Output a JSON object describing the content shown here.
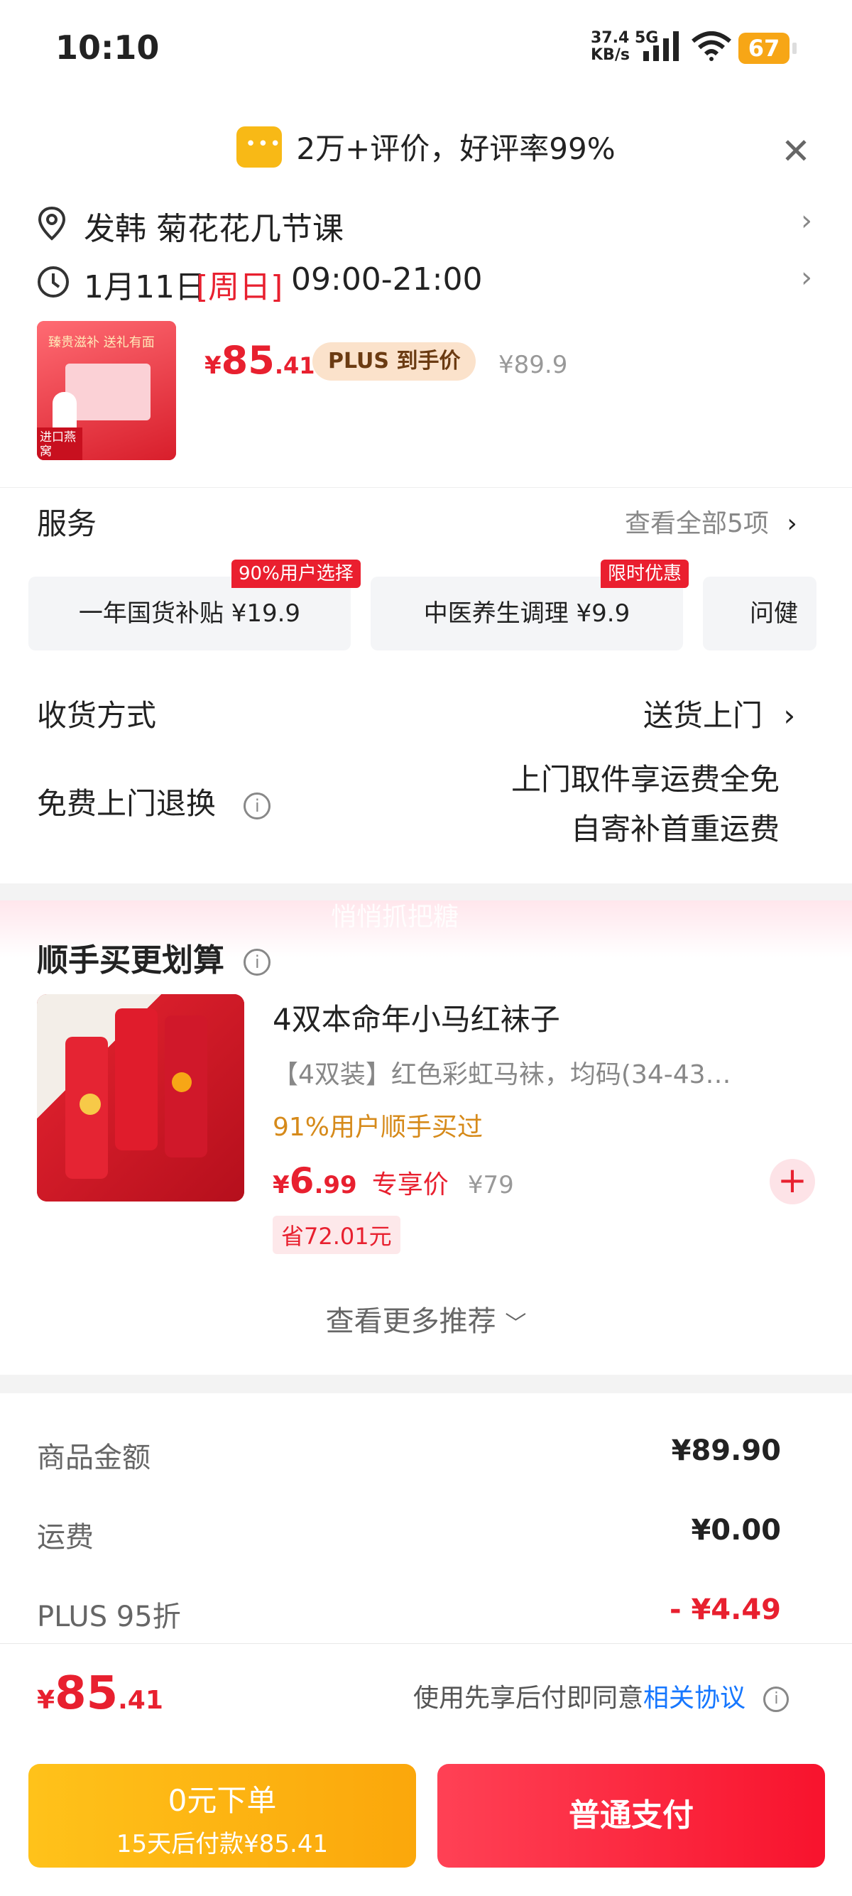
{
  "status": {
    "time": "10:10",
    "net_speed": "37.4",
    "net_unit": "KB/s",
    "net_type": "5G",
    "battery": "67"
  },
  "header": {
    "rating_text": "2万+评价，好评率99%"
  },
  "address": {
    "text": "发韩  菊花花几节课"
  },
  "delivery_time": {
    "date": "1月11日",
    "weekday": "[周日]",
    "range": "09:00-21:00"
  },
  "product": {
    "currency": "¥",
    "price_int": "85",
    "price_dec": ".41",
    "plus_badge_plus": "PLUS",
    "plus_badge_text": "到手价",
    "orig_price": "¥89.9",
    "image_text_top": "臻贵滋补  送礼有面",
    "image_text_corner": "进口燕窝"
  },
  "services": {
    "title": "服务",
    "view_all": "查看全部5项",
    "items": [
      {
        "tag": "90%用户选择",
        "label": "一年国货补贴  ¥19.9"
      },
      {
        "tag": "限时优惠",
        "label": "中医养生调理  ¥9.9"
      },
      {
        "tag": "",
        "label": "问健康"
      }
    ]
  },
  "shipping": {
    "label": "收货方式",
    "value": "送货上门"
  },
  "returns": {
    "label": "免费上门退换",
    "line1": "上门取件享运费全免",
    "line2": "自寄补首重运费"
  },
  "watermark": "悄悄抓把糖",
  "addon": {
    "title": "顺手买更划算",
    "item": {
      "name": "4双本命年小马红袜子",
      "desc": "【4双装】红色彩虹马袜，均码(34-43…",
      "social": "91%用户顺手买过",
      "currency": "¥",
      "price_int": "6",
      "price_dec": ".99",
      "price_label": "专享价",
      "orig_price": "¥79",
      "save": "省72.01元"
    },
    "more": "查看更多推荐"
  },
  "summary": {
    "rows": [
      {
        "label": "商品金额",
        "value": "¥89.90"
      },
      {
        "label": "运费",
        "value": "¥0.00"
      },
      {
        "label": "PLUS 95折",
        "value": "- ¥4.49"
      }
    ]
  },
  "footer": {
    "currency": "¥",
    "total_int": "85",
    "total_dec": ".41",
    "agree_text": "使用先享后付即同意",
    "agree_link": "相关协议"
  },
  "buttons": {
    "left_title": "0元下单",
    "left_sub": "15天后付款¥85.41",
    "right": "普通支付"
  },
  "colors": {
    "accent_red": "#e8202f",
    "orange": "#fba70b",
    "link_blue": "#1677ff"
  }
}
